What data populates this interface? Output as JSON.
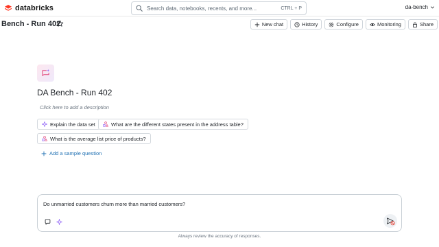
{
  "app": {
    "brand": "databricks"
  },
  "search": {
    "placeholder": "Search data, notebooks, recents, and more...",
    "shortcut": "CTRL + P"
  },
  "workspace": {
    "name": "da-bench"
  },
  "page": {
    "title": "Bench - Run 402"
  },
  "actions": [
    {
      "label": "New chat",
      "icon": "plus-icon"
    },
    {
      "label": "History",
      "icon": "history-icon"
    },
    {
      "label": "Configure",
      "icon": "gear-icon"
    },
    {
      "label": "Monitoring",
      "icon": "eye-icon"
    },
    {
      "label": "Share",
      "icon": "lock-icon"
    }
  ],
  "space": {
    "title": "DA Bench - Run 402",
    "description_placeholder": "Click here to add a description"
  },
  "sample_questions": [
    {
      "label": "Explain the data set",
      "icon": "sparkle-icon"
    },
    {
      "label": "What are the different states present in the address table?",
      "icon": "shapes-icon"
    },
    {
      "label": "What is the average list price of products?",
      "icon": "shapes-icon"
    }
  ],
  "add_sample_label": "Add a sample question",
  "composer": {
    "text": "Do unmarried customers churn more than married customers?"
  },
  "disclaimer": "Always review the accuracy of responses.",
  "colors": {
    "brand": "#ff3621",
    "link": "#2272b4",
    "accent": "#e0457b"
  }
}
